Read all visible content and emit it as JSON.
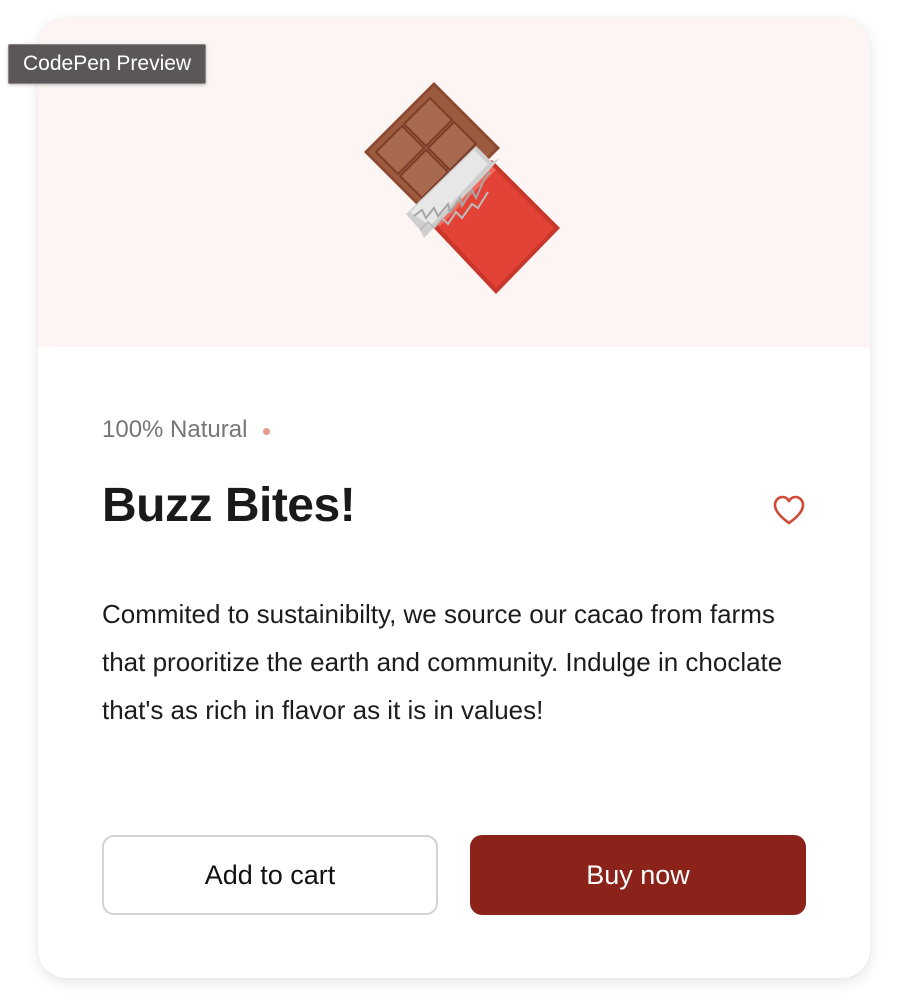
{
  "preview_badge": "CodePen Preview",
  "product": {
    "image_icon": "chocolate-bar-icon",
    "tagline": "100% Natural",
    "title": "Buzz Bites!",
    "description": "Commited to sustainibilty, we source our cacao from farms that prooritize the earth and community. In­dulge in choclate that's as rich in flavor as it is in val­ues!",
    "favorite_icon": "heart-icon"
  },
  "actions": {
    "add_to_cart_label": "Add to cart",
    "buy_now_label": "Buy now"
  },
  "colors": {
    "accent": "#8b231b",
    "hero_background": "#fcf5f4",
    "dot": "#e59a8c",
    "heart": "#d04b36"
  }
}
